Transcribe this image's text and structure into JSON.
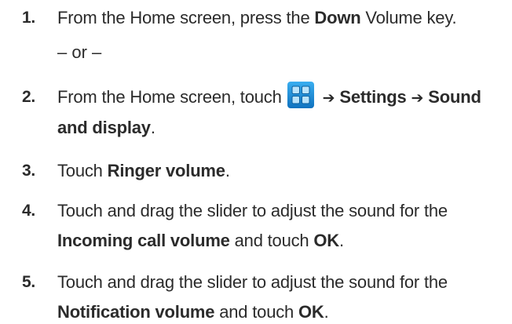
{
  "steps": [
    {
      "number": "1.",
      "parts": {
        "a": "From the Home screen, press the ",
        "b": "Down",
        "c": " Volume key."
      }
    },
    {
      "or_text": "– or –"
    },
    {
      "number": "2.",
      "parts": {
        "a": "From the Home screen, touch",
        "arrow1": "➔",
        "b": "Settings",
        "arrow2": "➔",
        "c": "Sound",
        "d": "and display",
        "e": "."
      },
      "icon": "apps-grid-icon"
    },
    {
      "number": "3.",
      "parts": {
        "a": "Touch ",
        "b": "Ringer volume",
        "c": "."
      }
    },
    {
      "number": "4.",
      "parts": {
        "a": "Touch and drag the slider to adjust the sound for the",
        "b": "Incoming call volume",
        "c": " and touch ",
        "d": "OK",
        "e": "."
      }
    },
    {
      "number": "5.",
      "parts": {
        "a": "Touch and drag the slider to adjust the sound for the",
        "b": "Notification volume",
        "c": " and touch ",
        "d": "OK",
        "e": "."
      }
    }
  ],
  "colors": {
    "text": "#2b2b2b",
    "icon_blue": "#1e8fd6",
    "icon_light_blue": "#9fd3f5"
  }
}
